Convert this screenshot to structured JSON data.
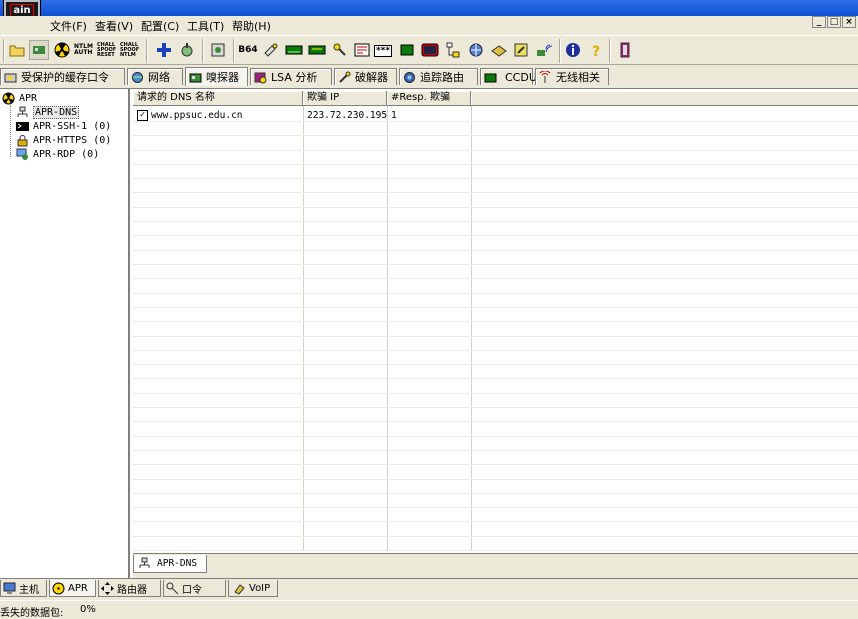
{
  "app": {
    "logo_text": "ain"
  },
  "menubar": {
    "items": [
      "文件(F)",
      "查看(V)",
      "配置(C)",
      "工具(T)",
      "帮助(H)"
    ],
    "mdi_buttons": [
      "_",
      "□",
      "×"
    ]
  },
  "toolbar": {
    "labels": {
      "ntlm_auth": "NTLM AUTH",
      "chall_spoof_reset": "CHALL SPOOF RESET",
      "chall_spoof_ntlm": "CHALL SPOOF NTLM",
      "b64": "B64",
      "stars": "***"
    },
    "icons": [
      "folder-open-icon",
      "network-card-icon",
      "sniffer-radiation-icon",
      "ntlm-auth-icon",
      "chall-spoof-reset-icon",
      "chall-spoof-ntlm-icon",
      "add-icon",
      "decoder-icon",
      "certificate-icon",
      "base64-icon",
      "hash-calculator-icon",
      "rsa-icon",
      "vpn-icon",
      "password-icon",
      "rdp-icon",
      "stars-icon",
      "wordlist-icon",
      "terminal-icon",
      "tree-icon",
      "network-icon",
      "wep-icon",
      "key-icon",
      "wireless-icon",
      "info-icon",
      "help-icon",
      "exit-icon"
    ]
  },
  "tabs": [
    {
      "label": "受保护的缓存口令",
      "icon": "protected-storage-icon"
    },
    {
      "label": "网络",
      "icon": "network-globe-icon"
    },
    {
      "label": "嗅探器",
      "icon": "sniffer-icon",
      "active": true
    },
    {
      "label": "LSA 分析",
      "icon": "lsa-icon"
    },
    {
      "label": "破解器",
      "icon": "cracker-icon"
    },
    {
      "label": "追踪路由",
      "icon": "traceroute-icon"
    },
    {
      "label": "CCDU",
      "icon": "ccdu-icon"
    },
    {
      "label": "无线相关",
      "icon": "wireless-icon"
    }
  ],
  "tree": {
    "root": "APR",
    "items": [
      {
        "label": "APR-DNS",
        "icon": "dns-icon",
        "selected": true
      },
      {
        "label": "APR-SSH-1  (0)",
        "icon": "ssh-terminal-icon"
      },
      {
        "label": "APR-HTTPS  (0)",
        "icon": "https-lock-icon"
      },
      {
        "label": "APR-RDP  (0)",
        "icon": "rdp-icon"
      }
    ]
  },
  "table": {
    "columns": [
      "请求的 DNS 名称",
      "欺骗 IP",
      "#Resp. 欺骗"
    ],
    "rows": [
      {
        "checked": true,
        "check_mark": "✓",
        "dns_name": "www.ppsuc.edu.cn",
        "spoof_ip": "223.72.230.195",
        "resp": "1"
      }
    ]
  },
  "subtab": {
    "label": "APR-DNS"
  },
  "bottom_tabs": [
    {
      "label": "主机",
      "icon": "host-icon"
    },
    {
      "label": "APR",
      "icon": "apr-radiation-icon",
      "active": true
    },
    {
      "label": "路由器",
      "icon": "router-icon"
    },
    {
      "label": "口令",
      "icon": "password-key-icon"
    },
    {
      "label": "VoIP",
      "icon": "voip-icon"
    }
  ],
  "status": {
    "label": "丢失的数据包:",
    "value": "0%"
  }
}
